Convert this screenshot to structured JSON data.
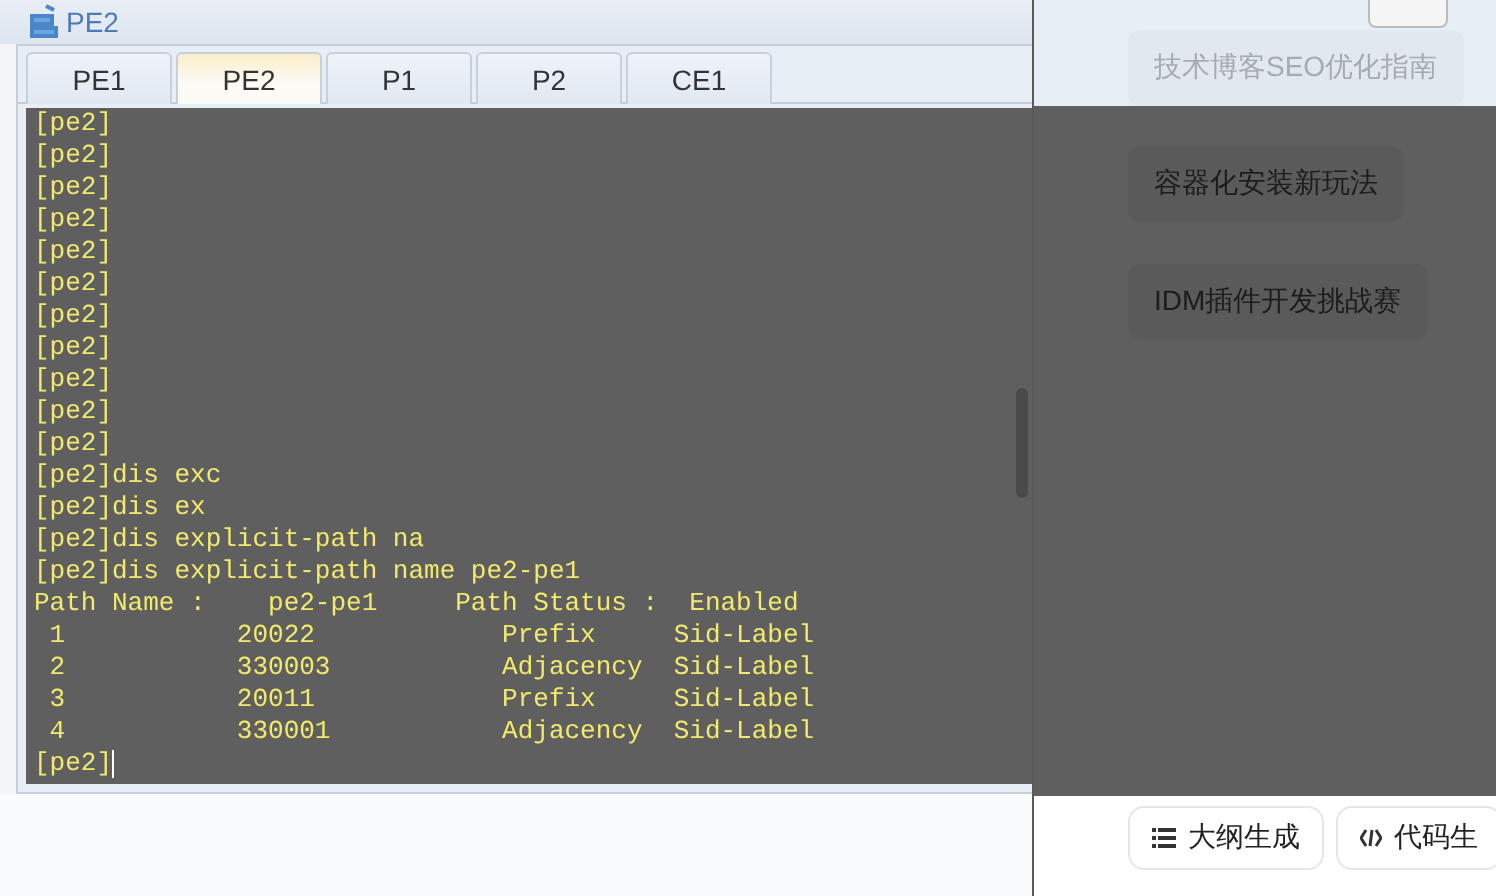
{
  "window": {
    "title": "PE2"
  },
  "tabs": [
    {
      "label": "PE1",
      "selected": false
    },
    {
      "label": "PE2",
      "selected": true
    },
    {
      "label": "P1",
      "selected": false
    },
    {
      "label": "P2",
      "selected": false
    },
    {
      "label": "CE1",
      "selected": false
    }
  ],
  "terminal": {
    "lines": [
      "[pe2]",
      "[pe2]",
      "[pe2]",
      "[pe2]",
      "[pe2]",
      "[pe2]",
      "[pe2]",
      "[pe2]",
      "[pe2]",
      "[pe2]",
      "[pe2]",
      "[pe2]dis exc",
      "[pe2]dis ex",
      "[pe2]dis explicit-path na",
      "[pe2]dis explicit-path name pe2-pe1",
      "Path Name :    pe2-pe1     Path Status :  Enabled",
      " 1           20022            Prefix     Sid-Label",
      " 2           330003           Adjacency  Sid-Label",
      " 3           20011            Prefix     Sid-Label",
      " 4           330001           Adjacency  Sid-Label"
    ],
    "prompt": "[pe2]"
  },
  "suggestions": [
    "技术博客SEO优化指南",
    "容器化安装新玩法",
    "IDM插件开发挑战赛"
  ],
  "bottom_actions": [
    {
      "label": "大纲生成",
      "kind": "outline"
    },
    {
      "label": "代码生",
      "kind": "code"
    }
  ]
}
